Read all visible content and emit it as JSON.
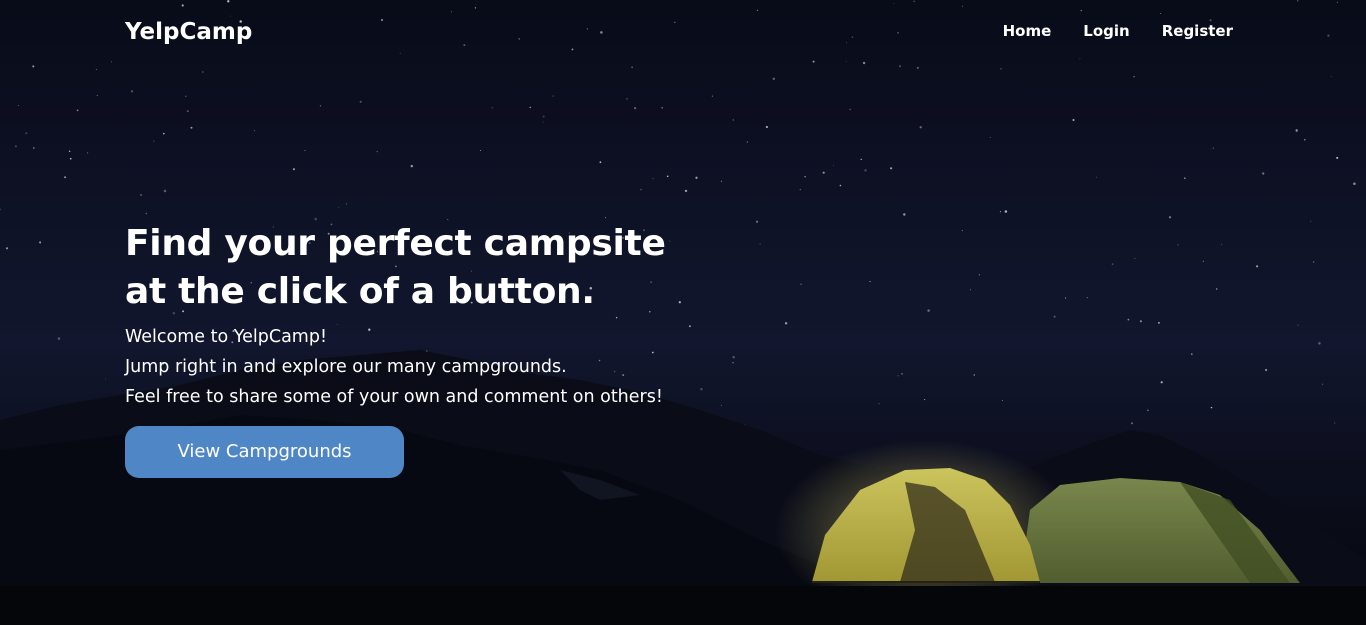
{
  "nav": {
    "brand": "YelpCamp",
    "links": [
      {
        "label": "Home"
      },
      {
        "label": "Login"
      },
      {
        "label": "Register"
      }
    ]
  },
  "hero": {
    "title_lines": [
      "Find your perfect campsite",
      "at the click of a button."
    ],
    "paragraphs": [
      "Welcome to YelpCamp!",
      "Jump right in and explore our many campgrounds.",
      "Feel free to share some of your own and comment on others!"
    ],
    "cta_label": "View Campgrounds"
  },
  "colors": {
    "accent": "#4f86c6",
    "text": "#ffffff",
    "background": "#10142a"
  }
}
